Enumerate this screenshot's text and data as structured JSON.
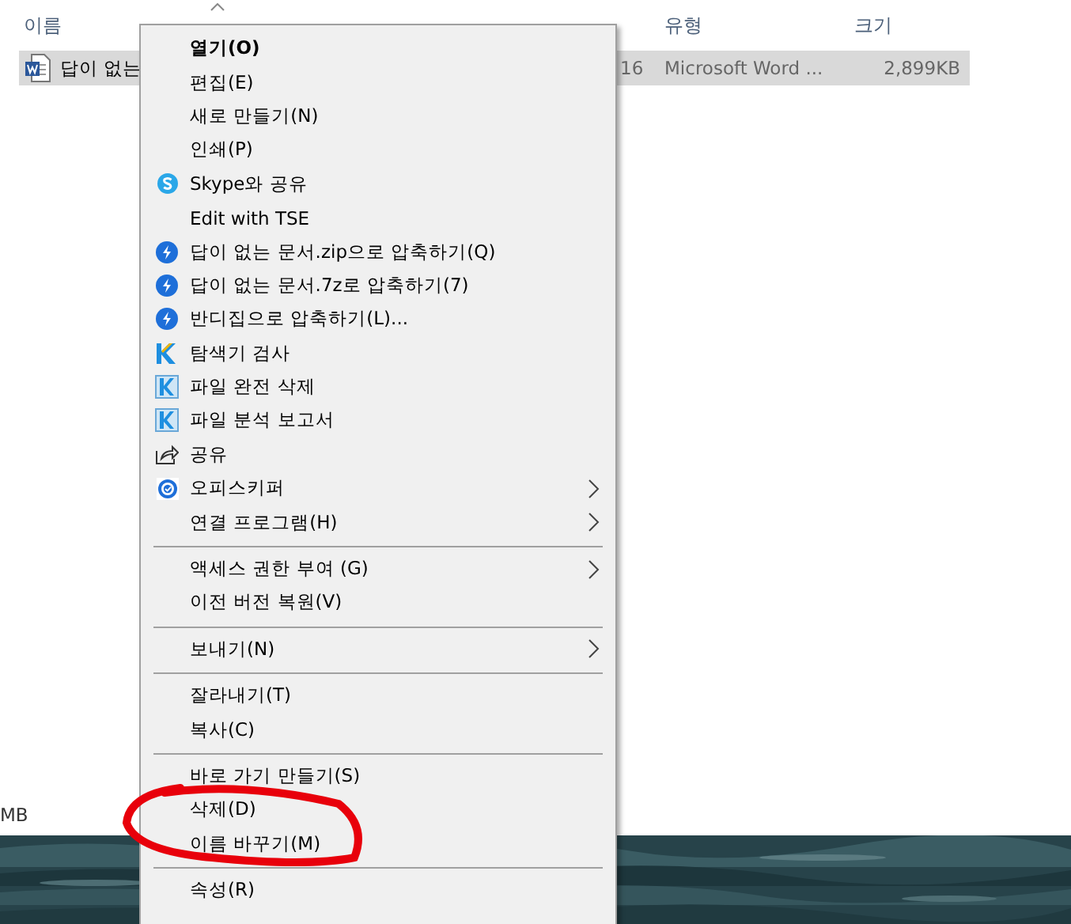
{
  "explorer": {
    "columns": [
      {
        "label": "이름"
      },
      {
        "label": "유형"
      },
      {
        "label": "크기"
      }
    ],
    "rows": [
      {
        "name": "답이 없는",
        "modified": "16",
        "type": "Microsoft Word ...",
        "size": "2,899KB",
        "selected": true
      }
    ],
    "status_text": "MB"
  },
  "context_menu": {
    "items": [
      {
        "kind": "item",
        "label": "열기(O)",
        "default": true,
        "submenu": false
      },
      {
        "kind": "item",
        "label": "편집(E)",
        "default": false,
        "submenu": false
      },
      {
        "kind": "item",
        "label": "새로 만들기(N)",
        "default": false,
        "submenu": false
      },
      {
        "kind": "item",
        "label": "인쇄(P)",
        "default": false,
        "submenu": false
      },
      {
        "kind": "skype",
        "label": "Skype와 공유",
        "default": false,
        "submenu": false
      },
      {
        "kind": "item",
        "label": "Edit with TSE",
        "default": false,
        "submenu": false
      },
      {
        "kind": "zip",
        "label": "답이 없는 문서.zip으로 압축하기(Q)",
        "default": false,
        "submenu": false
      },
      {
        "kind": "zip",
        "label": "답이 없는 문서.7z로 압축하기(7)",
        "default": false,
        "submenu": false
      },
      {
        "kind": "zip",
        "label": "반디집으로 압축하기(L)...",
        "default": false,
        "submenu": false
      },
      {
        "kind": "scan",
        "label": "탐색기 검사",
        "default": false,
        "submenu": false
      },
      {
        "kind": "tool",
        "label": "파일 완전 삭제",
        "default": false,
        "submenu": false
      },
      {
        "kind": "tool",
        "label": "파일 분석 보고서",
        "default": false,
        "submenu": false
      },
      {
        "kind": "share",
        "label": "공유",
        "default": false,
        "submenu": false
      },
      {
        "kind": "keeper",
        "label": "오피스키퍼",
        "default": false,
        "submenu": true
      },
      {
        "kind": "item",
        "label": "연결 프로그램(H)",
        "default": false,
        "submenu": true
      },
      {
        "kind": "separator"
      },
      {
        "kind": "item",
        "label": "액세스 권한 부여 (G)",
        "default": false,
        "submenu": true
      },
      {
        "kind": "item",
        "label": "이전 버전 복원(V)",
        "default": false,
        "submenu": false
      },
      {
        "kind": "separator"
      },
      {
        "kind": "item",
        "label": "보내기(N)",
        "default": false,
        "submenu": true
      },
      {
        "kind": "separator"
      },
      {
        "kind": "item",
        "label": "잘라내기(T)",
        "default": false,
        "submenu": false
      },
      {
        "kind": "item",
        "label": "복사(C)",
        "default": false,
        "submenu": false
      },
      {
        "kind": "separator"
      },
      {
        "kind": "item",
        "label": "바로 가기 만들기(S)",
        "default": false,
        "submenu": false
      },
      {
        "kind": "item",
        "label": "삭제(D)",
        "default": false,
        "submenu": false
      },
      {
        "kind": "item",
        "label": "이름 바꾸기(M)",
        "default": false,
        "submenu": false
      },
      {
        "kind": "separator"
      },
      {
        "kind": "item",
        "label": "속성(R)",
        "default": false,
        "submenu": false
      }
    ]
  }
}
